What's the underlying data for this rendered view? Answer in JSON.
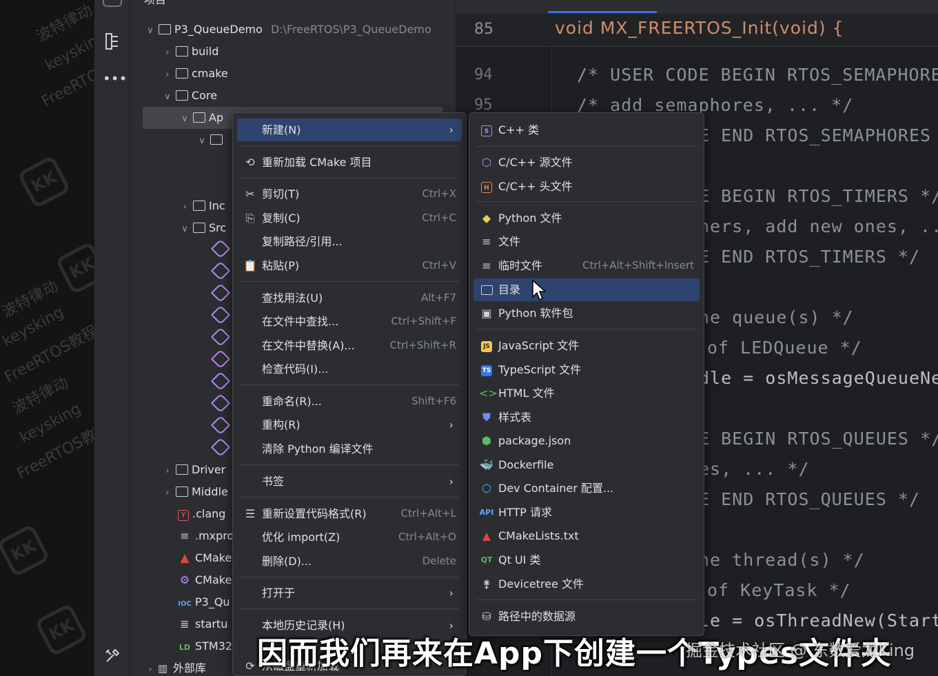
{
  "watermark_side": [
    "波特律动",
    "keysking",
    "FreeRTOS教程",
    "KK"
  ],
  "project_tree": {
    "root": {
      "name": "P3_QueueDemo",
      "path": "D:\\FreeRTOS\\P3_QueueDemo"
    },
    "rows": [
      {
        "label": "build"
      },
      {
        "label": "cmake"
      },
      {
        "label": "Core"
      },
      {
        "label": "Ap"
      },
      {
        "label": ""
      },
      {
        "label": "Inc"
      },
      {
        "label": "Src"
      },
      {
        "label": "Driver"
      },
      {
        "label": "Middle"
      },
      {
        "label": ".clang"
      },
      {
        "label": ".mxpro"
      },
      {
        "label": "CMake"
      },
      {
        "label": "CMake"
      },
      {
        "label": "P3_Qu"
      },
      {
        "label": "startu"
      },
      {
        "label": "STM32"
      },
      {
        "label": "外部库"
      }
    ]
  },
  "editor": {
    "sticky_line": "85",
    "sticky_code": "void MX_FREERTOS_Init(void) {",
    "line_numbers": [
      "94",
      "95"
    ],
    "code_lines": [
      "/* USER CODE BEGIN RTOS_SEMAPHORE",
      "/* add semaphores, ... */",
      "E END RTOS_SEMAPHORES",
      "",
      "E BEGIN RTOS_TIMERS */",
      "ners, add new ones, ..",
      "E END RTOS_TIMERS */",
      "",
      "ne queue(s) */",
      "of LEDQueue */",
      "dle = osMessageQueueNe",
      "",
      "E BEGIN RTOS_QUEUES */",
      "es, ... */",
      "E END RTOS_QUEUES */",
      "",
      "ne thread(s) */",
      "of KeyTask */",
      "le = osThreadNew(Start"
    ]
  },
  "context_menu": {
    "items": [
      {
        "label": "新建(N)",
        "shortcut": "",
        "submenu": true
      },
      {
        "label": "重新加载 CMake 项目",
        "shortcut": "",
        "submenu": false
      },
      {
        "label": "剪切(T)",
        "shortcut": "Ctrl+X",
        "submenu": false
      },
      {
        "label": "复制(C)",
        "shortcut": "Ctrl+C",
        "submenu": false
      },
      {
        "label": "复制路径/引用...",
        "shortcut": "",
        "submenu": false
      },
      {
        "label": "粘贴(P)",
        "shortcut": "Ctrl+V",
        "submenu": false
      },
      {
        "label": "查找用法(U)",
        "shortcut": "Alt+F7",
        "submenu": false
      },
      {
        "label": "在文件中查找...",
        "shortcut": "Ctrl+Shift+F",
        "submenu": false
      },
      {
        "label": "在文件中替换(A)...",
        "shortcut": "Ctrl+Shift+R",
        "submenu": false
      },
      {
        "label": "检查代码(I)...",
        "shortcut": "",
        "submenu": false
      },
      {
        "label": "重命名(R)...",
        "shortcut": "Shift+F6",
        "submenu": false
      },
      {
        "label": "重构(R)",
        "shortcut": "",
        "submenu": true
      },
      {
        "label": "清除 Python 编译文件",
        "shortcut": "",
        "submenu": false
      },
      {
        "label": "书签",
        "shortcut": "",
        "submenu": true
      },
      {
        "label": "重新设置代码格式(R)",
        "shortcut": "Ctrl+Alt+L",
        "submenu": false
      },
      {
        "label": "优化 import(Z)",
        "shortcut": "Ctrl+Alt+O",
        "submenu": false
      },
      {
        "label": "删除(D)...",
        "shortcut": "Delete",
        "submenu": false
      },
      {
        "label": "打开于",
        "shortcut": "",
        "submenu": true
      },
      {
        "label": "本地历史记录(H)",
        "shortcut": "",
        "submenu": true
      },
      {
        "label": "从磁盘重新加载",
        "shortcut": "",
        "submenu": false
      }
    ]
  },
  "new_submenu": {
    "items": [
      {
        "label": "C++ 类",
        "shortcut": ""
      },
      {
        "label": "C/C++ 源文件",
        "shortcut": ""
      },
      {
        "label": "C/C++ 头文件",
        "shortcut": ""
      },
      {
        "label": "Python 文件",
        "shortcut": ""
      },
      {
        "label": "文件",
        "shortcut": ""
      },
      {
        "label": "临时文件",
        "shortcut": "Ctrl+Alt+Shift+Insert"
      },
      {
        "label": "目录",
        "shortcut": ""
      },
      {
        "label": "Python 软件包",
        "shortcut": ""
      },
      {
        "label": "JavaScript 文件",
        "shortcut": ""
      },
      {
        "label": "TypeScript 文件",
        "shortcut": ""
      },
      {
        "label": "HTML 文件",
        "shortcut": ""
      },
      {
        "label": "样式表",
        "shortcut": ""
      },
      {
        "label": "package.json",
        "shortcut": ""
      },
      {
        "label": "Dockerfile",
        "shortcut": ""
      },
      {
        "label": "Dev Container 配置...",
        "shortcut": ""
      },
      {
        "label": "HTTP 请求",
        "shortcut": ""
      },
      {
        "label": "CMakeLists.txt",
        "shortcut": ""
      },
      {
        "label": "Qt UI 类",
        "shortcut": ""
      },
      {
        "label": "Devicetree 文件",
        "shortcut": ""
      },
      {
        "label": "路径中的数据源",
        "shortcut": ""
      }
    ]
  },
  "icon_badges": {
    "js": "JS",
    "ts": "TS",
    "api": "API",
    "qt": "QT",
    "ioc": "IOC",
    "ld": "LD",
    "y": "Y"
  },
  "subtitle": "因而我们再来在App下创建一个Types文件夹",
  "site_watermark": "掘金技术社区 @ 东数爱龙King",
  "colors": {
    "accent_selection": "#2e436e",
    "background": "#2b2d30",
    "editor_bg": "#1e1f22"
  }
}
